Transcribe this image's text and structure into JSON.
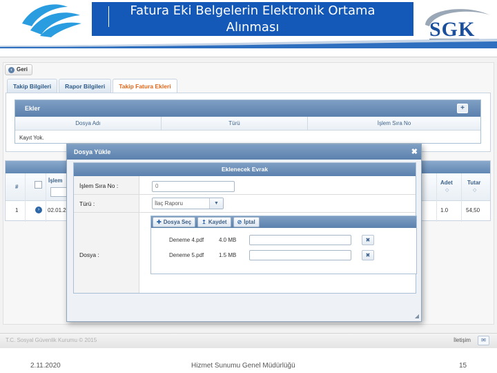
{
  "slide": {
    "title_line1": "Fatura Eki Belgelerin Elektronik Ortama",
    "title_line2": "Alınması",
    "logo_right_text": "SGK",
    "footer_date": "2.11.2020",
    "footer_center": "Hizmet Sunumu Genel Müdürlüğü",
    "footer_page": "15"
  },
  "colors": {
    "title_bg": "#1458b8",
    "header_blue": "#5b81ad",
    "active_tab": "#e2661a"
  },
  "app": {
    "back_label": "Geri",
    "tabs": [
      {
        "label": "Takip Bilgileri",
        "active": false
      },
      {
        "label": "Rapor Bilgileri",
        "active": false
      },
      {
        "label": "Takip Fatura Ekleri",
        "active": true
      }
    ],
    "ekler": {
      "title": "Ekler",
      "add_icon": "plus-icon",
      "columns": [
        "Dosya Adı",
        "Türü",
        "İşlem Sıra No"
      ],
      "empty_text": "Kayıt Yok."
    },
    "grid": {
      "hash_header": "#",
      "islem_header": "İşlem",
      "adet_header": "Adet",
      "tutar_header": "Tutar",
      "row": {
        "no": "1",
        "date": "02.01.2",
        "adet": "1.0",
        "tutar": "54,50"
      }
    },
    "footer": {
      "copyright": "T.C. Sosyal Güvenlik Kurumu © 2015",
      "contact": "İletişim"
    }
  },
  "modal": {
    "title": "Dosya Yükle",
    "section_title": "Eklenecek Evrak",
    "islem_label": "İşlem Sıra No :",
    "islem_value": "0",
    "tur_label": "Türü :",
    "tur_selected": "İlaç Raporu",
    "dosya_label": "Dosya :",
    "buttons": {
      "choose": "Dosya Seç",
      "save": "Kaydet",
      "cancel": "İptal"
    },
    "files": [
      {
        "name": "Deneme 4.pdf",
        "size": "4.0 MB"
      },
      {
        "name": "Deneme 5.pdf",
        "size": "1.5 MB"
      }
    ]
  }
}
